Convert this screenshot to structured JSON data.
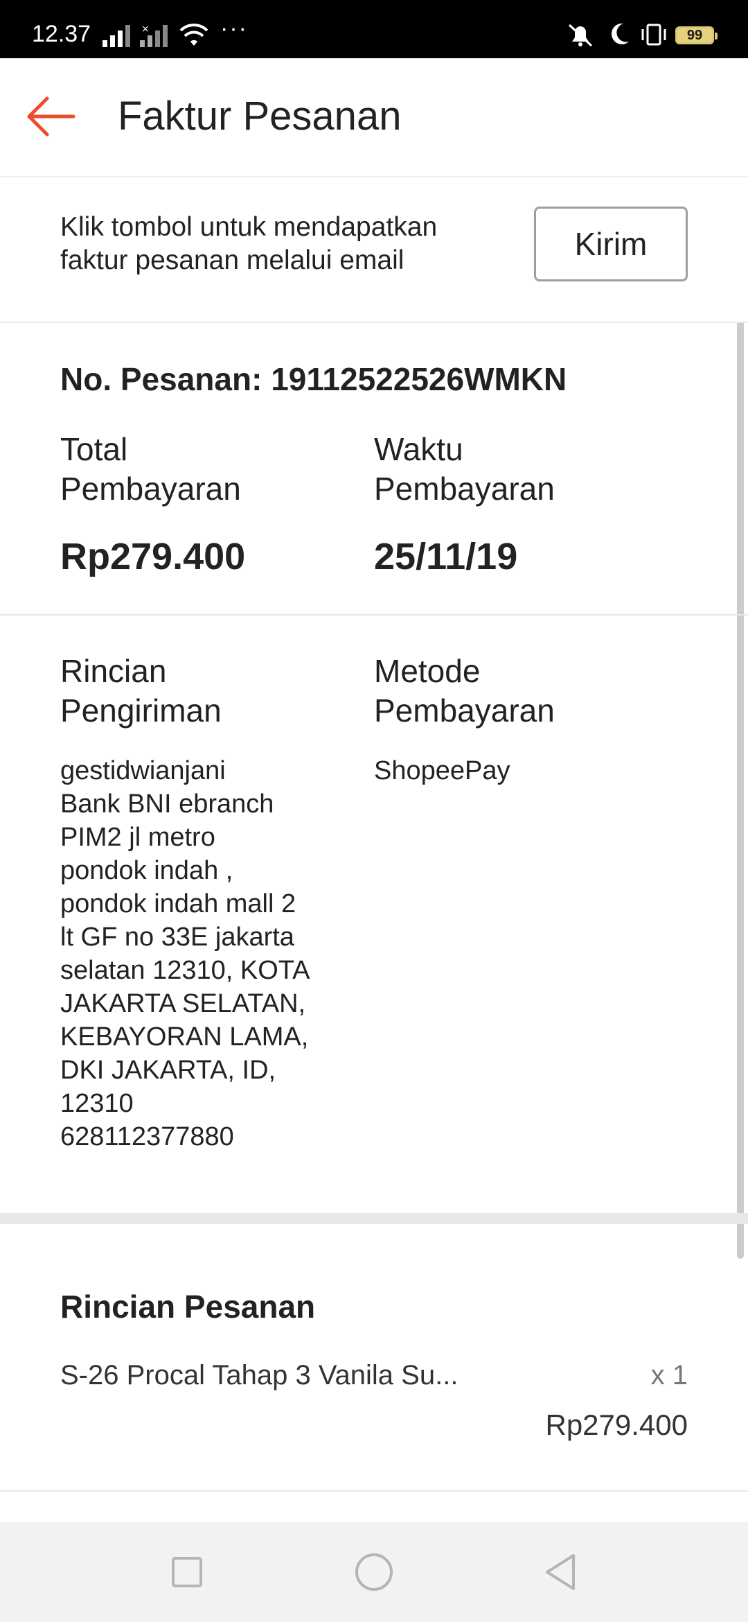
{
  "status_bar": {
    "time": "12.37",
    "battery": "99",
    "overflow": "···"
  },
  "header": {
    "title": "Faktur Pesanan",
    "back_icon": "arrow-left-icon",
    "accent_color": "#ee4d2d"
  },
  "email_section": {
    "text": "Klik tombol untuk mendapatkan faktur pesanan melalui email",
    "button_label": "Kirim"
  },
  "order": {
    "number_label": "No. Pesanan: 19112522526WMKN",
    "total_label": "Total Pembayaran",
    "total_value": "Rp279.400",
    "time_label": "Waktu Pembayaran",
    "time_value": "25/11/19"
  },
  "shipping": {
    "label": "Rincian Pengiriman",
    "details": "gestidwianjani\nBank BNI ebranch\nPIM2 jl metro\npondok indah ,\npondok indah mall 2\nlt GF no 33E jakarta\nselatan 12310, KOTA\nJAKARTA SELATAN,\nKEBAYORAN LAMA,\nDKI JAKARTA, ID,\n12310\n628112377880"
  },
  "payment": {
    "label": "Metode Pembayaran",
    "method": "ShopeePay"
  },
  "order_details": {
    "title": "Rincian Pesanan",
    "items": [
      {
        "name": "S-26 Procal Tahap 3 Vanila Su...",
        "qty": "x 1",
        "price": "Rp279.400"
      }
    ]
  },
  "nav_bar": {
    "buttons": [
      "square-recents-icon",
      "circle-home-icon",
      "triangle-back-icon"
    ]
  }
}
